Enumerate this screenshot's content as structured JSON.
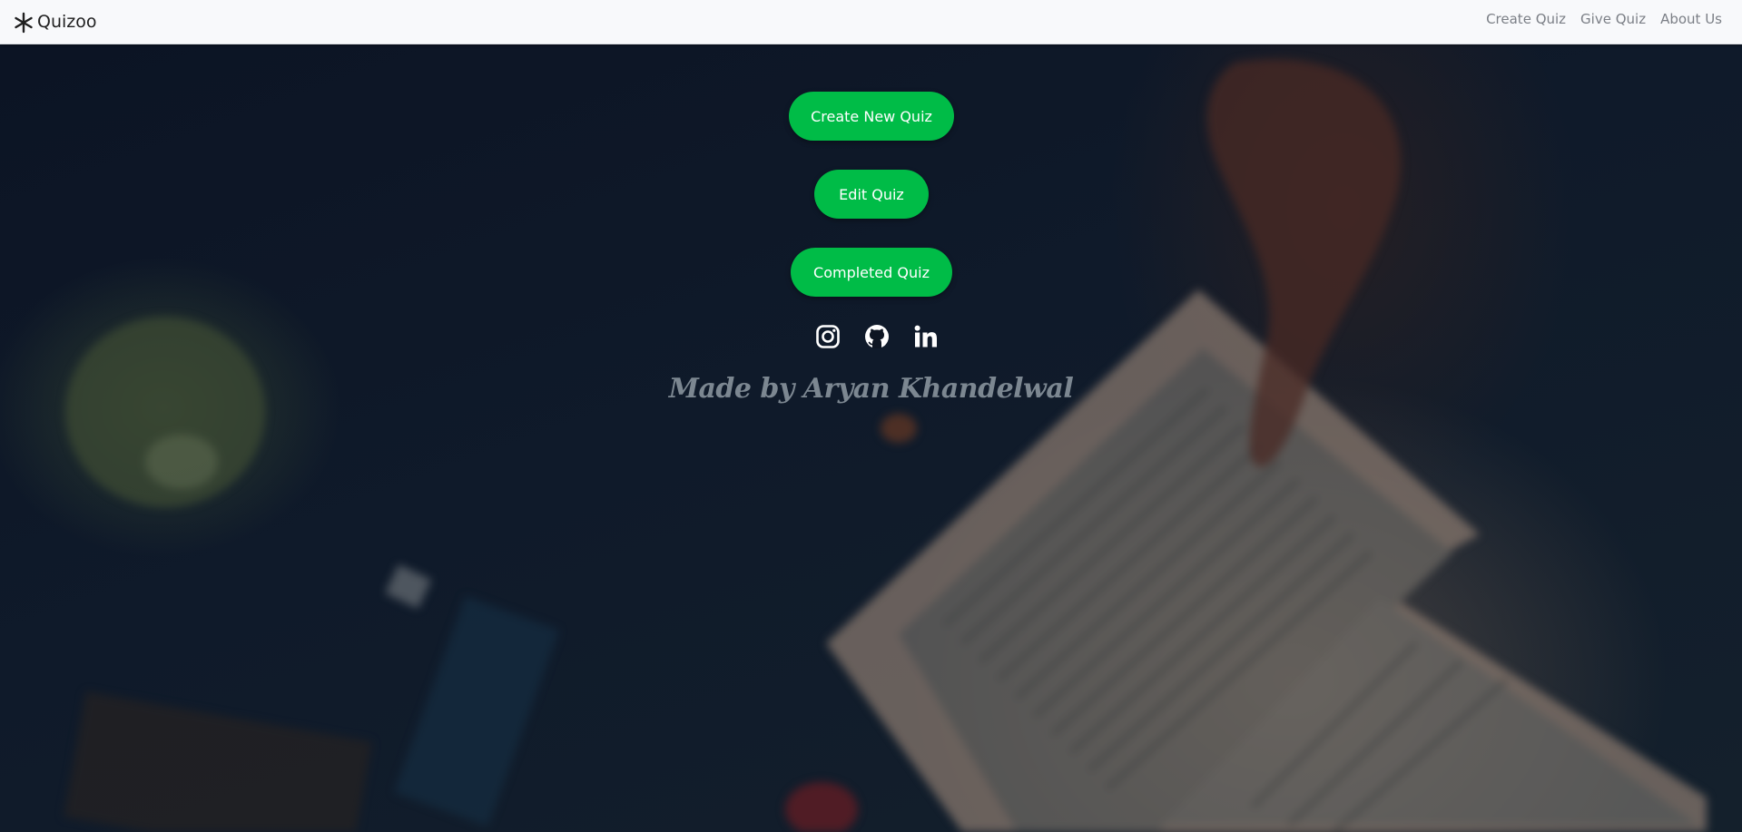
{
  "navbar": {
    "brand_icon": "asterisk-icon",
    "brand_name": "Quizoo",
    "links": [
      {
        "label": "Create Quiz"
      },
      {
        "label": "Give Quiz"
      },
      {
        "label": "About Us"
      }
    ]
  },
  "hero": {
    "background": "blurred-photo-open-book",
    "buttons": {
      "create_new": "Create New Quiz",
      "edit": "Edit Quiz",
      "completed": "Completed Quiz"
    },
    "socials": [
      {
        "icon": "instagram-icon"
      },
      {
        "icon": "github-icon"
      },
      {
        "icon": "linkedin-icon"
      }
    ],
    "credit": "Made by Aryan Khandelwal"
  },
  "colors": {
    "accent_green": "#00bc47",
    "navbar_bg": "#f8f9fb",
    "nav_link": "#7b7f86",
    "credit_text": "#7c8791"
  }
}
